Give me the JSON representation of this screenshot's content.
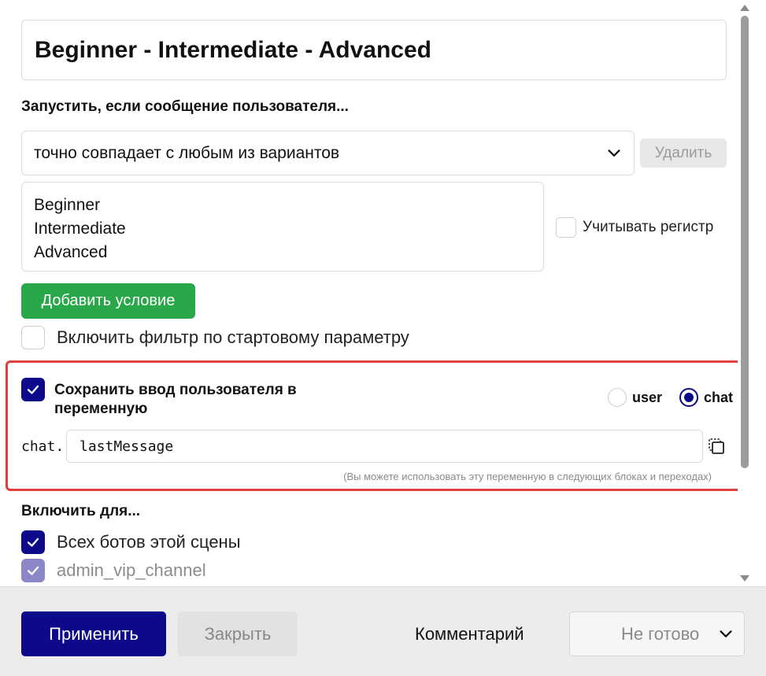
{
  "trigger": {
    "title": "Beginner - Intermediate - Advanced",
    "condition_label": "Запустить, если сообщение пользователя...",
    "condition_mode": "точно совпадает с любым из вариантов",
    "delete_label": "Удалить",
    "variants": [
      "Beginner",
      "Intermediate",
      "Advanced"
    ],
    "case_sensitive_label": "Учитывать регистр",
    "case_sensitive_checked": false,
    "add_condition_label": "Добавить условие",
    "start_param_label": "Включить фильтр по стартовому параметру",
    "start_param_checked": false
  },
  "save_input": {
    "checked": true,
    "label": "Сохранить ввод пользователя в переменную",
    "scope_options": [
      "user",
      "chat"
    ],
    "scope_selected": "chat",
    "prefix": "chat.",
    "variable_name": "lastMessage",
    "hint": "(Вы можете использовать эту переменную в следующих блоках и переходах)"
  },
  "enable_for": {
    "label": "Включить для...",
    "items": [
      {
        "label": "Всех ботов этой сцены",
        "checked": true
      },
      {
        "label": "admin_vip_channel",
        "checked": true
      }
    ]
  },
  "footer": {
    "apply_label": "Применить",
    "close_label": "Закрыть",
    "comment_label": "Комментарий",
    "status_value": "Не готово"
  },
  "colors": {
    "primary": "#0c0a8a",
    "success": "#29a84a",
    "highlight_border": "#e0403b"
  },
  "icons": [
    "chevron-down-icon",
    "checkmark-icon",
    "copy-icon",
    "scroll-up-icon",
    "scroll-down-icon"
  ]
}
